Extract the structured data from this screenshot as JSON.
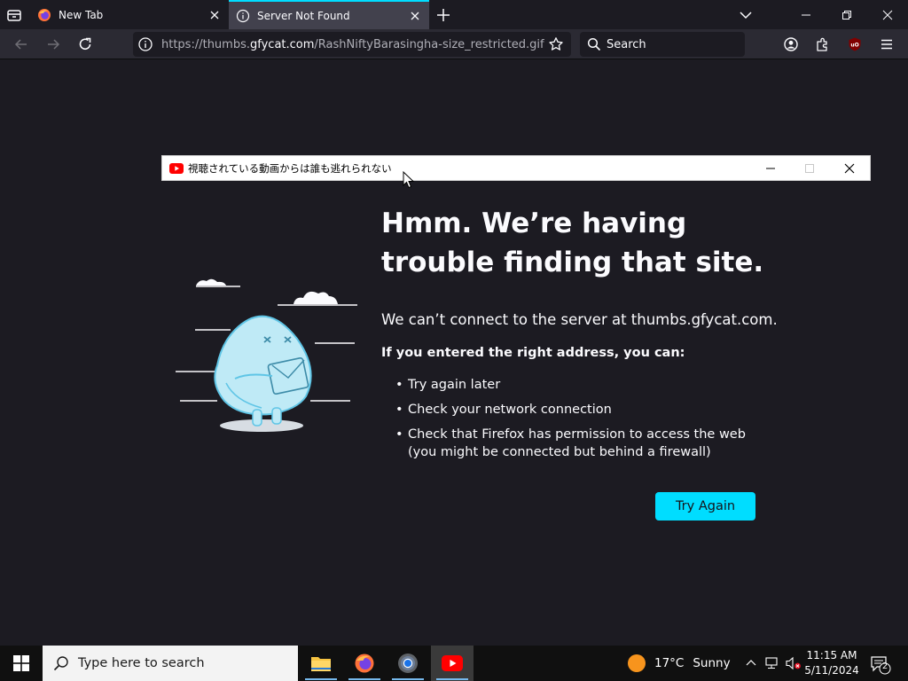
{
  "browser": {
    "tabs": [
      {
        "title": "New Tab",
        "active": false
      },
      {
        "title": "Server Not Found",
        "active": true
      }
    ],
    "url_prefix": "https://thumbs.",
    "url_host": "gfycat.com",
    "url_path": "/RashNiftyBarasingha-size_restricted.gif",
    "search_placeholder": "Search",
    "accent_color": "#00ddff"
  },
  "error_page": {
    "title": "Hmm. We’re having trouble finding that site.",
    "intro": "We can’t connect to the server at thumbs.gfycat.com.",
    "subhead": "If you entered the right address, you can:",
    "suggestions": [
      "Try again later",
      "Check your network connection",
      "Check that Firefox has permission to access the web (you might be connected but behind a firewall)"
    ],
    "button": "Try Again"
  },
  "overlay_window": {
    "title": "視聴されている動画からは誰も逃れられない",
    "icon": "youtube-icon"
  },
  "taskbar": {
    "search_placeholder": "Type here to search",
    "apps": [
      "file-explorer-icon",
      "firefox-icon",
      "chrome-icon",
      "youtube-icon"
    ],
    "weather_temp": "17°C",
    "weather_desc": "Sunny",
    "time": "11:15 AM",
    "date": "5/11/2024",
    "notification_count": "2"
  }
}
